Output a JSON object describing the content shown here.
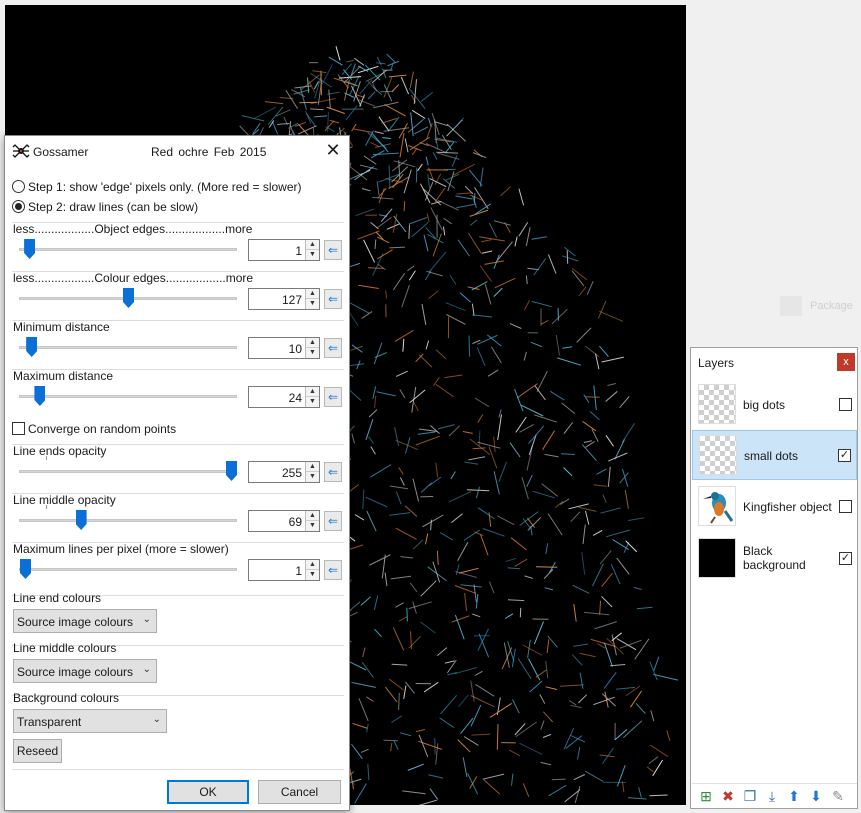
{
  "dialog": {
    "title": "Gossamer",
    "subtitle": "Red ochre   Feb 2015",
    "close_glyph": "✕",
    "step1_label": "Step 1: show 'edge' pixels only. (More red = slower)",
    "step2_label": "Step 2: draw lines (can be slow)",
    "step_selected": 2,
    "sliders": [
      {
        "label": "less..................Object edges..................more",
        "value": "1",
        "level": 0.02
      },
      {
        "label": "less..................Colour edges..................more",
        "value": "127",
        "level": 0.5
      },
      {
        "label": "Minimum distance",
        "value": "10",
        "level": 0.03
      },
      {
        "label": "Maximum distance",
        "value": "24",
        "level": 0.07
      }
    ],
    "converge_label": "Converge on random points",
    "converge_checked": false,
    "sliders2": [
      {
        "label": "Line ends opacity",
        "value": "255",
        "level": 1.0
      },
      {
        "label": "Line middle opacity",
        "value": "69",
        "level": 0.27
      }
    ],
    "max_lines": {
      "label": "Maximum lines per pixel (more = slower)",
      "value": "1",
      "level": 0.0
    },
    "line_end_colours": {
      "label": "Line end colours",
      "selected": "Source image colours"
    },
    "line_middle_colours": {
      "label": "Line middle colours",
      "selected": "Source image colours"
    },
    "background_colours": {
      "label": "Background colours",
      "selected": "Transparent"
    },
    "reseed_label": "Reseed",
    "ok_label": "OK",
    "cancel_label": "Cancel",
    "reset_glyph": "⇐",
    "spin_up": "▲",
    "spin_down": "▼",
    "chevron": "⌄"
  },
  "layers": {
    "title": "Layers",
    "close_glyph": "x",
    "items": [
      {
        "name": "big dots",
        "visible": false,
        "selected": false,
        "thumb": "checker"
      },
      {
        "name": "small dots",
        "visible": true,
        "selected": true,
        "thumb": "checker"
      },
      {
        "name": "Kingfisher object",
        "visible": false,
        "selected": false,
        "thumb": "bird"
      },
      {
        "name": "Black background",
        "visible": true,
        "selected": false,
        "thumb": "black"
      }
    ],
    "toolbar_icons": [
      "add-layer-icon",
      "delete-layer-icon",
      "duplicate-layer-icon",
      "merge-down-icon",
      "move-up-icon",
      "move-down-icon",
      "properties-icon"
    ]
  },
  "ghost": {
    "label": "Package"
  },
  "colors": {
    "accent": "#0078d7",
    "thumb": "#0a6fd6",
    "close_red": "#c0392b",
    "selection": "#cce4f7"
  }
}
